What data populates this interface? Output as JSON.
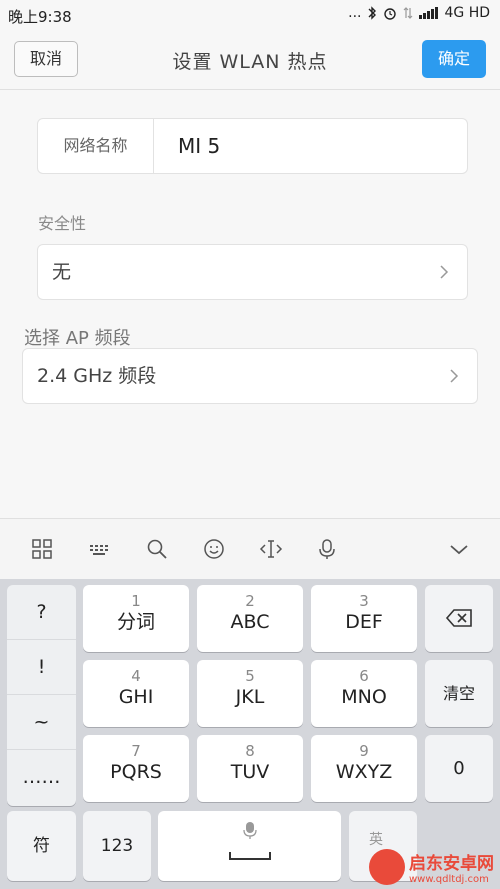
{
  "status": {
    "time": "晚上9:38",
    "network": "4G HD",
    "dots": "..."
  },
  "header": {
    "cancel": "取消",
    "title": "设置 WLAN 热点",
    "confirm": "确定"
  },
  "form": {
    "name_label": "网络名称",
    "name_value": "MI 5",
    "security_label": "安全性",
    "security_value": "无",
    "band_label": "选择 AP 频段",
    "band_value": "2.4 GHz 频段"
  },
  "toolbar": {
    "icons": [
      "grid-icon",
      "keyboard-icon",
      "search-icon",
      "emoji-icon",
      "cursor-icon",
      "microphone-icon",
      "collapse-icon"
    ]
  },
  "keyboard": {
    "symbols": [
      "?",
      "!",
      "~",
      "……"
    ],
    "keys": [
      {
        "num": "1",
        "letters": "分词"
      },
      {
        "num": "2",
        "letters": "ABC"
      },
      {
        "num": "3",
        "letters": "DEF"
      },
      {
        "num": "4",
        "letters": "GHI"
      },
      {
        "num": "5",
        "letters": "JKL"
      },
      {
        "num": "6",
        "letters": "MNO"
      },
      {
        "num": "7",
        "letters": "PQRS"
      },
      {
        "num": "8",
        "letters": "TUV"
      },
      {
        "num": "9",
        "letters": "WXYZ"
      }
    ],
    "clear": "清空",
    "zero": "0",
    "fu": "符",
    "num123": "123",
    "lang": "英"
  },
  "watermark": {
    "brand": "启东安卓网",
    "url": "www.qdltdj.com"
  }
}
